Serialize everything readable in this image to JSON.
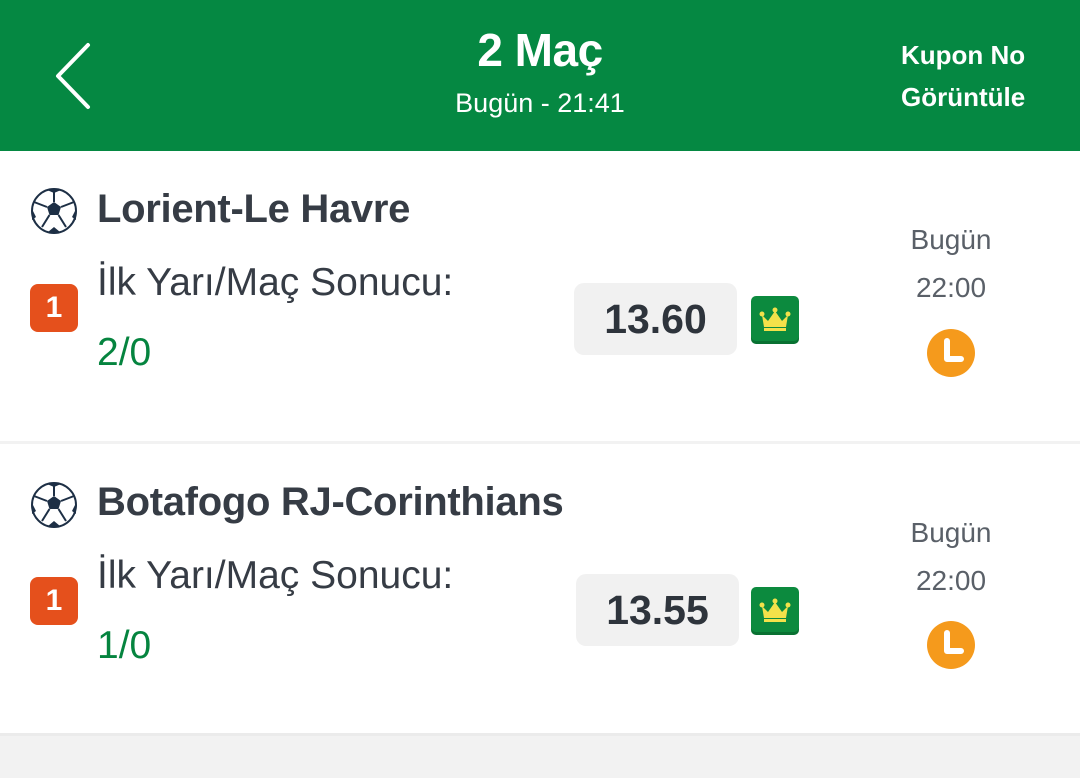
{
  "header": {
    "title": "2 Maç",
    "subtitle": "Bugün - 21:41",
    "kupon_line1": "Kupon No",
    "kupon_line2": "Görüntüle",
    "bg_color": "#058842"
  },
  "matches": [
    {
      "name": "Lorient-Le Havre",
      "badge": "1",
      "market": "İlk Yarı/Maç Sonucu:",
      "selection": "2/0",
      "odd": "13.60",
      "day": "Bugün",
      "time": "22:00",
      "sport_icon": "soccer-ball-icon",
      "crown_icon": "crown-icon",
      "status_icon": "clock-icon"
    },
    {
      "name": "Botafogo RJ-Corinthians",
      "badge": "1",
      "market": "İlk Yarı/Maç Sonucu:",
      "selection": "1/0",
      "odd": "13.55",
      "day": "Bugün",
      "time": "22:00",
      "sport_icon": "soccer-ball-icon",
      "crown_icon": "crown-icon",
      "status_icon": "clock-icon"
    }
  ],
  "colors": {
    "accent_green": "#05843f",
    "badge_orange": "#e5501c",
    "clock_orange": "#f59a1c"
  }
}
